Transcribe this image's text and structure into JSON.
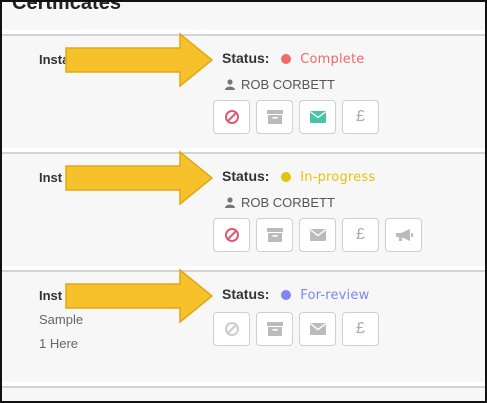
{
  "page": {
    "title": "Certificates"
  },
  "colors": {
    "arrow": "#f6c12a",
    "arrow_outline": "#e0a814",
    "complete": "#f06a6a",
    "inprogress": "#e3c40a",
    "forreview": "#7d86f2",
    "ban_active": "#e05a73",
    "envelope_active": "#45c4a6"
  },
  "cards": [
    {
      "inst_label": "Insta",
      "status_key": "Status:",
      "status_value": "Complete",
      "user": "ROB CORBETT",
      "actions": [
        "ban-icon",
        "archive-icon",
        "envelope-icon",
        "pound-icon"
      ]
    },
    {
      "inst_label": "Inst",
      "status_key": "Status:",
      "status_value": "In-progress",
      "user": "ROB CORBETT",
      "actions": [
        "ban-icon",
        "archive-icon",
        "envelope-icon",
        "pound-icon",
        "megaphone-icon"
      ]
    },
    {
      "inst_label": "Inst",
      "status_key": "Status:",
      "status_value": "For-review",
      "meta_1": "Sample",
      "meta_2": "1 Here",
      "actions": [
        "ban-icon",
        "archive-icon",
        "envelope-icon",
        "pound-icon"
      ]
    }
  ],
  "icons": {
    "pound": "£"
  }
}
